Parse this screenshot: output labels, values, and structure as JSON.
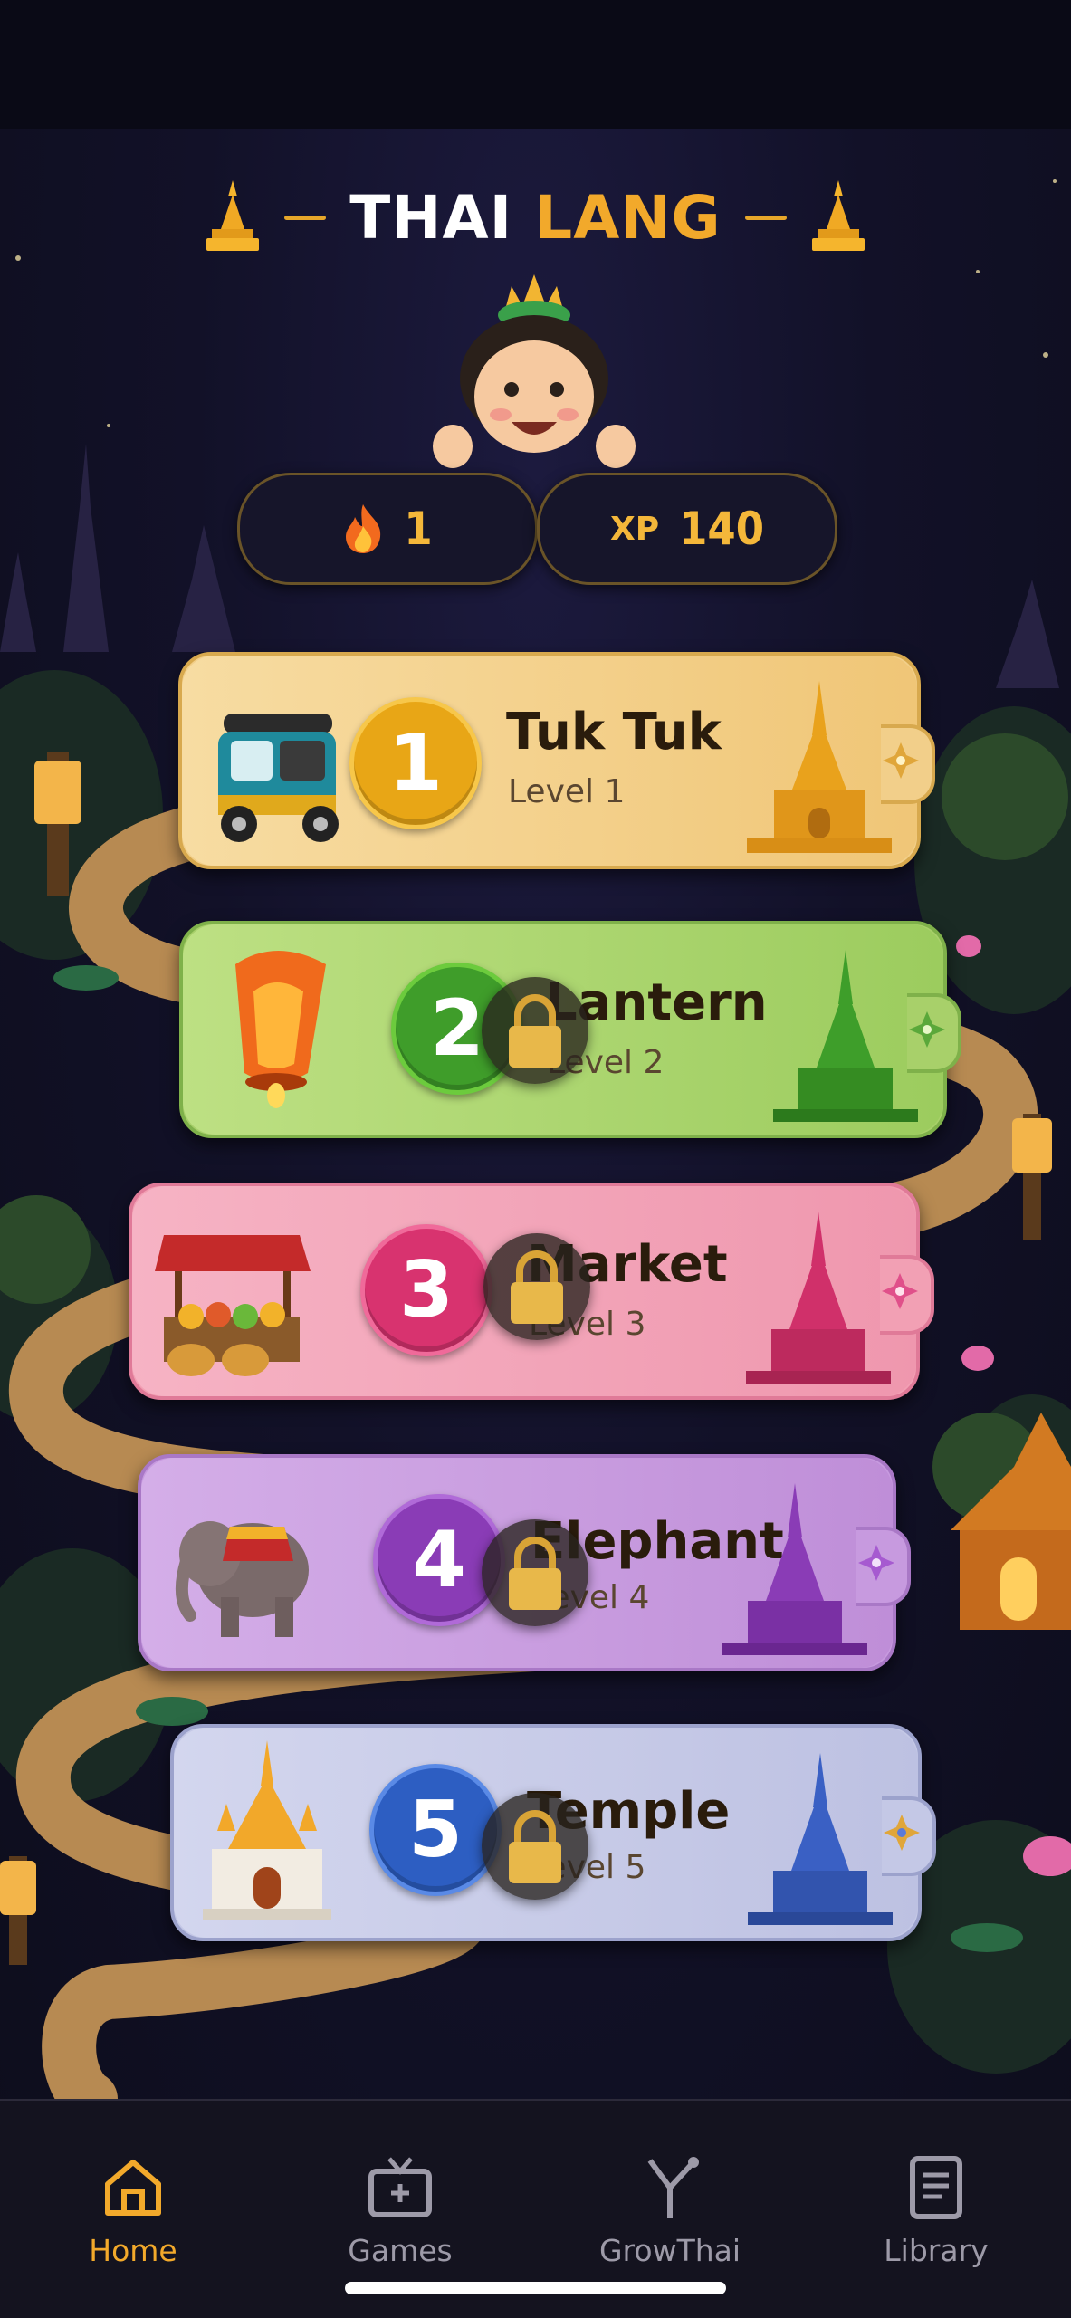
{
  "header": {
    "title_word1": "THAI",
    "title_word2": "LANG"
  },
  "stats": {
    "streak_icon": "fire-icon",
    "streak_value": "1",
    "xp_label": "XP",
    "xp_value": "140"
  },
  "levels": [
    {
      "number": "1",
      "name": "Tuk Tuk",
      "level": "Level 1",
      "locked": false,
      "art": "tuk-tuk-icon",
      "color": "#e8a616"
    },
    {
      "number": "2",
      "name": "Lantern",
      "level": "Level 2",
      "locked": true,
      "art": "lantern-icon",
      "color": "#3f9d2a"
    },
    {
      "number": "3",
      "name": "Market",
      "level": "Level 3",
      "locked": true,
      "art": "market-stall-icon",
      "color": "#d8336f"
    },
    {
      "number": "4",
      "name": "Elephant",
      "level": "Level 4",
      "locked": true,
      "art": "elephant-icon",
      "color": "#8a3cb6"
    },
    {
      "number": "5",
      "name": "Temple",
      "level": "Level 5",
      "locked": true,
      "art": "temple-icon",
      "color": "#2d5ec2"
    }
  ],
  "nav": [
    {
      "label": "Home",
      "icon": "home-icon",
      "active": true
    },
    {
      "label": "Games",
      "icon": "tv-icon",
      "active": false
    },
    {
      "label": "GrowThai",
      "icon": "sprout-icon",
      "active": false
    },
    {
      "label": "Library",
      "icon": "book-icon",
      "active": false
    }
  ],
  "colors": {
    "accent": "#f2a92b",
    "background": "#121128"
  }
}
